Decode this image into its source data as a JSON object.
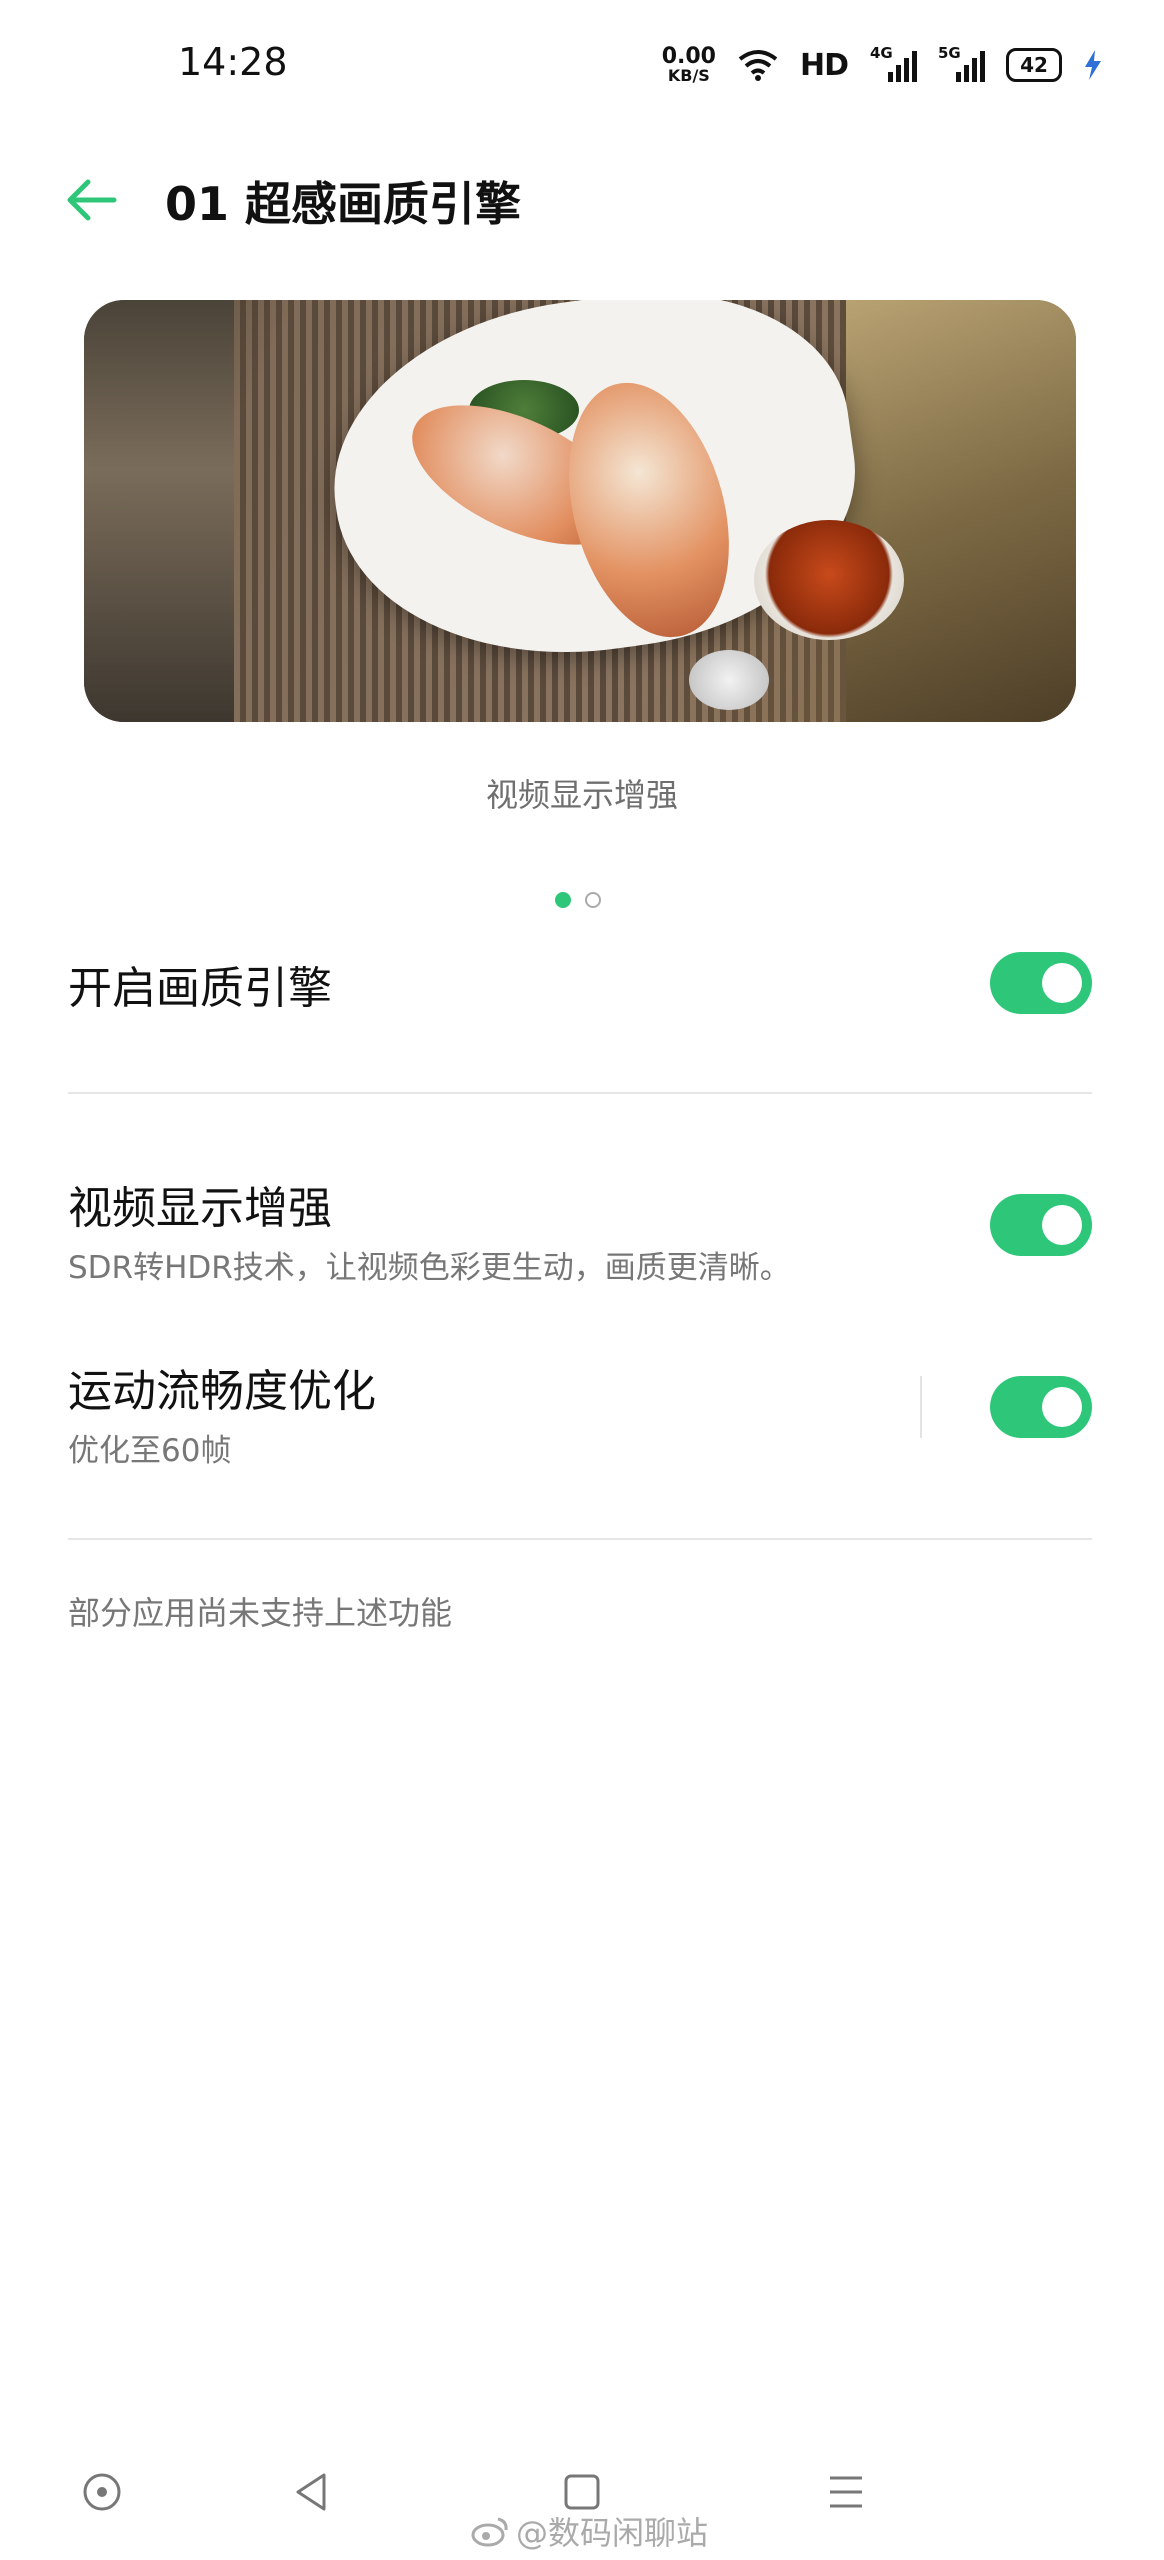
{
  "status_bar": {
    "time": "14:28",
    "net_speed_value": "0.00",
    "net_speed_unit": "KB/S",
    "hd_label": "HD",
    "network1": "4G",
    "network2": "5G",
    "battery": "42"
  },
  "header": {
    "title": "01 超感画质引擎",
    "back_icon": "arrow-left-icon",
    "accent_color": "#2ec77a"
  },
  "banner": {
    "caption": "视频显示增强",
    "page_count": 2,
    "active_index": 0
  },
  "settings": {
    "engine": {
      "title": "开启画质引擎",
      "enabled": true
    },
    "video_enhance": {
      "title": "视频显示增强",
      "subtitle": "SDR转HDR技术，让视频色彩更生动，画质更清晰。",
      "enabled": true
    },
    "motion_smooth": {
      "title": "运动流畅度优化",
      "subtitle": "优化至60帧",
      "enabled": true
    }
  },
  "note": "部分应用尚未支持上述功能",
  "nav_bar": {
    "icons": [
      "record-icon",
      "back-triangle-icon",
      "home-square-icon",
      "menu-lines-icon"
    ]
  },
  "watermark": "@数码闲聊站"
}
